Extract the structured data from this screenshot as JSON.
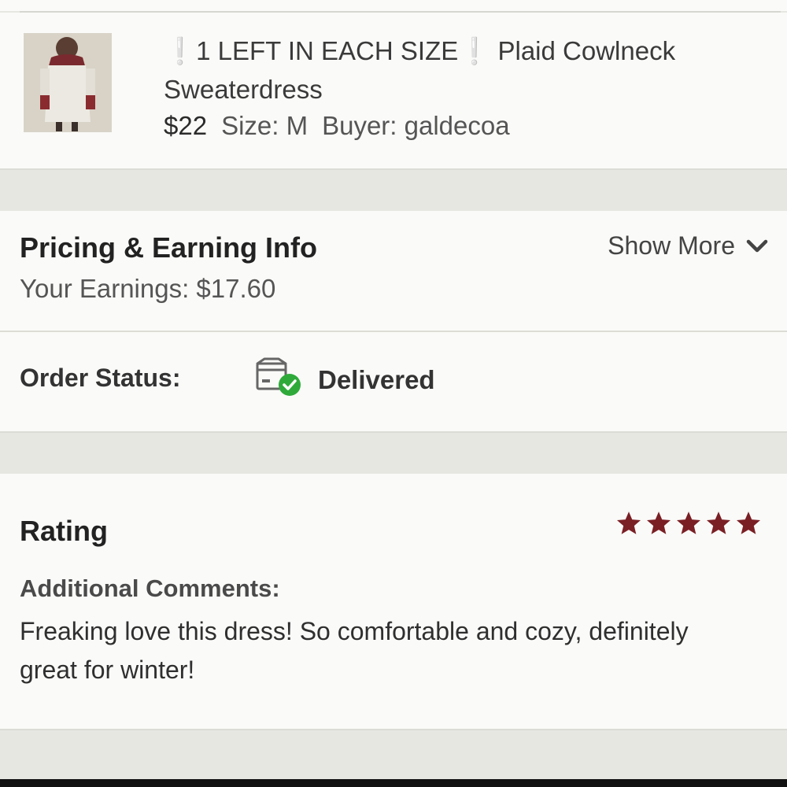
{
  "item": {
    "title": "❕1 LEFT IN EACH SIZE❕ Plaid Cowlneck Sweaterdress",
    "price": "$22",
    "size": "Size: M",
    "buyer": "Buyer: galdecoa"
  },
  "pricing": {
    "title": "Pricing & Earning Info",
    "earnings": "Your Earnings: $17.60",
    "show_more": "Show More"
  },
  "order_status": {
    "label": "Order Status:",
    "value": "Delivered"
  },
  "rating": {
    "title": "Rating",
    "stars": 5,
    "star_color": "#7a1f24",
    "comments_label": "Additional Comments:",
    "comments": "Freaking love this dress! So comfortable and cozy, definitely great for winter!"
  },
  "colors": {
    "background": "#e7e7e2",
    "card": "#fafaf8",
    "delivered_check": "#2faa3a"
  }
}
